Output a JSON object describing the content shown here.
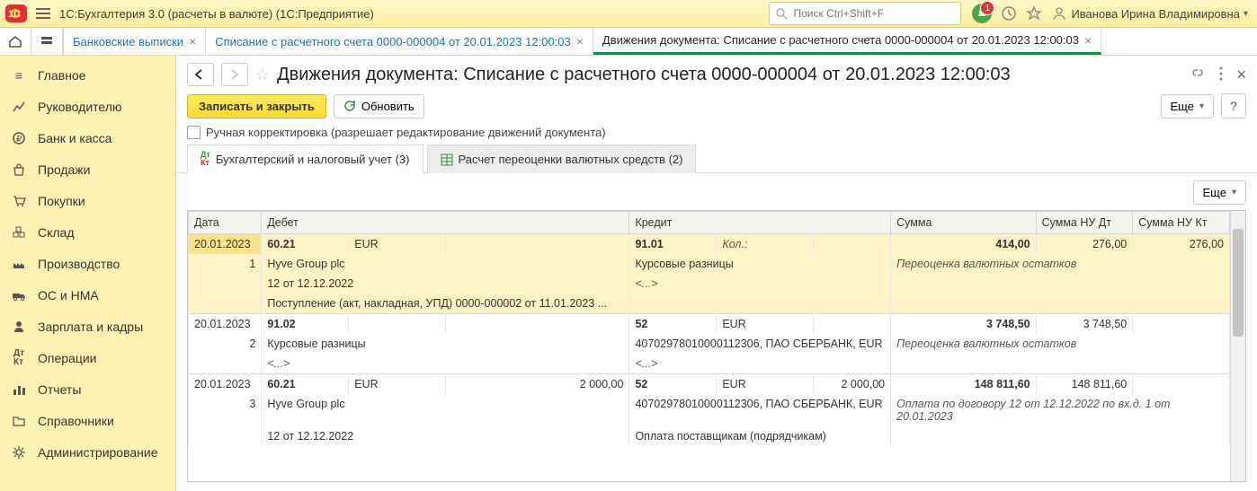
{
  "top": {
    "title": "1С:Бухгалтерия 3.0 (расчеты в валюте)  (1С:Предприятие)",
    "search_placeholder": "Поиск Ctrl+Shift+F",
    "bell_badge": "1",
    "user_name": "Иванова Ирина Владимировна"
  },
  "tabs": {
    "items": [
      {
        "label": "Банковские выписки",
        "closable": true
      },
      {
        "label": "Списание с расчетного счета 0000-000004 от 20.01.2023 12:00:03",
        "closable": true
      },
      {
        "label": "Движения документа: Списание с расчетного счета 0000-000004 от 20.01.2023 12:00:03",
        "closable": true,
        "active": true
      }
    ]
  },
  "sidebar": {
    "items": [
      {
        "label": "Главное"
      },
      {
        "label": "Руководителю"
      },
      {
        "label": "Банк и касса"
      },
      {
        "label": "Продажи"
      },
      {
        "label": "Покупки"
      },
      {
        "label": "Склад"
      },
      {
        "label": "Производство"
      },
      {
        "label": "ОС и НМА"
      },
      {
        "label": "Зарплата и кадры"
      },
      {
        "label": "Операции"
      },
      {
        "label": "Отчеты"
      },
      {
        "label": "Справочники"
      },
      {
        "label": "Администрирование"
      }
    ]
  },
  "page": {
    "title": "Движения документа: Списание с расчетного счета 0000-000004 от 20.01.2023 12:00:03",
    "btn_save_close": "Записать и закрыть",
    "btn_refresh": "Обновить",
    "btn_more": "Еще",
    "checkbox_label": "Ручная корректировка (разрешает редактирование движений документа)",
    "subtabs": [
      {
        "label": "Бухгалтерский и налоговый учет (3)",
        "active": true
      },
      {
        "label": "Расчет переоценки валютных средств (2)"
      }
    ]
  },
  "grid": {
    "headers": {
      "date": "Дата",
      "debit": "Дебет",
      "credit": "Кредит",
      "sum": "Сумма",
      "sum_nu_dt": "Сумма НУ Дт",
      "sum_nu_kt": "Сумма НУ Кт"
    },
    "rows": [
      {
        "highlight": true,
        "date": "20.01.2023",
        "n": "1",
        "debit_acc": "60.21",
        "debit_cur": "EUR",
        "debit_qty": "",
        "credit_acc": "91.01",
        "credit_cur": "",
        "credit_qty_label": "Кол.:",
        "sum": "414,00",
        "nu_dt": "276,00",
        "nu_kt": "276,00",
        "d_line2": "Hyve Group plc",
        "c_line2": "Курсовые разницы",
        "comment": "Переоценка валютных остатков",
        "d_line3": "12 от 12.12.2022",
        "c_line3": "<...>",
        "d_line4": "Поступление (акт, накладная, УПД) 0000-000002 от 11.01.2023 ..."
      },
      {
        "date": "20.01.2023",
        "n": "2",
        "debit_acc": "91.02",
        "debit_cur": "",
        "credit_acc": "52",
        "credit_cur": "EUR",
        "sum": "3 748,50",
        "nu_dt": "3 748,50",
        "nu_kt": "",
        "d_line2": "Курсовые разницы",
        "c_line2": "40702978010000112306, ПАО СБЕРБАНК, EUR",
        "comment": "Переоценка валютных остатков",
        "d_line3": "<...>",
        "c_line3": "<...>"
      },
      {
        "date": "20.01.2023",
        "n": "3",
        "debit_acc": "60.21",
        "debit_cur": "EUR",
        "debit_qty": "2 000,00",
        "credit_acc": "52",
        "credit_cur": "EUR",
        "credit_qty": "2 000,00",
        "sum": "148 811,60",
        "nu_dt": "148 811,60",
        "nu_kt": "",
        "d_line2": "Hyve Group plc",
        "c_line2": "40702978010000112306, ПАО СБЕРБАНК, EUR",
        "comment": "Оплата по договору 12 от 12.12.2022 по вх.д. 1 от 20.01.2023",
        "d_line3": "12 от 12.12.2022",
        "c_line3": "Оплата поставщикам (подрядчикам)"
      }
    ]
  }
}
